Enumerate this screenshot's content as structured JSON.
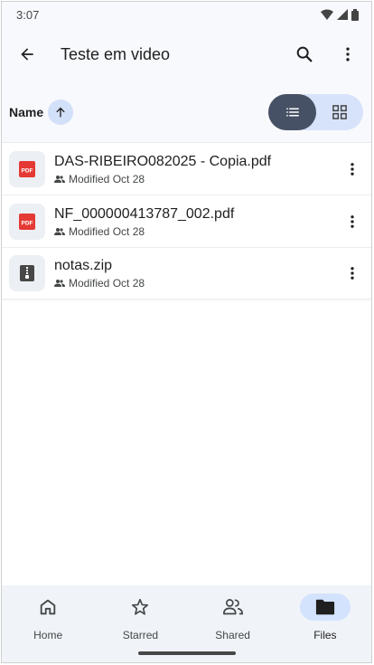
{
  "status_bar": {
    "time": "3:07"
  },
  "app_bar": {
    "title": "Teste em video"
  },
  "sort": {
    "label": "Name"
  },
  "files": [
    {
      "name": "DAS-RIBEIRO082025 - Copia.pdf",
      "type_icon": "pdf-icon",
      "type_label": "PDF",
      "meta": "Modified Oct 28"
    },
    {
      "name": "NF_000000413787_002.pdf",
      "type_icon": "pdf-icon",
      "type_label": "PDF",
      "meta": "Modified Oct 28"
    },
    {
      "name": "notas.zip",
      "type_icon": "zip-icon",
      "type_label": "",
      "meta": "Modified Oct 28"
    }
  ],
  "bottom_nav": [
    {
      "label": "Home",
      "icon": "home-icon",
      "active": false
    },
    {
      "label": "Starred",
      "icon": "star-icon",
      "active": false
    },
    {
      "label": "Shared",
      "icon": "shared-icon",
      "active": false
    },
    {
      "label": "Files",
      "icon": "folder-icon",
      "active": true
    }
  ],
  "colors": {
    "accent": "#d3e3fd",
    "view_toggle_active": "#475165",
    "pdf_red": "#e53935"
  }
}
